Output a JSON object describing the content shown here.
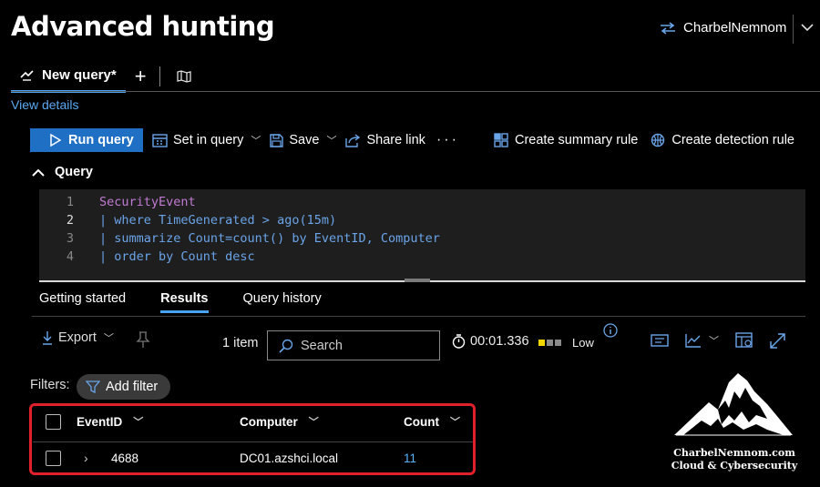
{
  "page": {
    "title": "Advanced hunting"
  },
  "user": {
    "name": "CharbelNemnom"
  },
  "tabs": {
    "active": "New query*"
  },
  "links": {
    "view_details": "View details"
  },
  "toolbar": {
    "run_query": "Run query",
    "set_in_query": "Set in query",
    "save": "Save",
    "share_link": "Share link",
    "more": "···",
    "create_summary_rule": "Create summary rule",
    "create_detection_rule": "Create detection rule"
  },
  "query": {
    "header": "Query",
    "line_numbers": [
      "1",
      "2",
      "3",
      "4"
    ],
    "lines": [
      "SecurityEvent",
      "| where TimeGenerated > ago(15m)",
      "| summarize Count=count() by EventID, Computer",
      "| order by Count desc"
    ]
  },
  "result_tabs": [
    "Getting started",
    "Results",
    "Query history"
  ],
  "results_toolbar": {
    "export": "Export",
    "items": "1 item",
    "search_placeholder": "Search",
    "elapsed": "00:01.336",
    "level": "Low",
    "level_colors": [
      "#f2d600",
      "#8a8a8a",
      "#8a8a8a"
    ]
  },
  "filters": {
    "label": "Filters:",
    "add_filter": "Add filter"
  },
  "table": {
    "columns": [
      "EventID",
      "Computer",
      "Count"
    ],
    "rows": [
      {
        "EventID": "4688",
        "Computer": "DC01.azshci.local",
        "Count": "11"
      }
    ]
  },
  "watermark": {
    "line1": "CharbelNemnom.com",
    "line2": "Cloud & Cybersecurity"
  },
  "colors": {
    "accent": "#1f6fc4",
    "link": "#5aa8f0",
    "highlight_box": "#e0202a"
  },
  "icons": [
    "switch-tenant-icon",
    "chevron-down-icon",
    "query-icon",
    "plus-icon",
    "map-icon",
    "play-icon",
    "calendar-icon",
    "save-icon",
    "share-icon",
    "summary-rule-icon",
    "detection-rule-icon",
    "chevron-up-icon",
    "download-icon",
    "pin-icon",
    "search-icon",
    "timer-icon",
    "info-icon",
    "chart-icon",
    "columns-icon",
    "expand-icon",
    "filter-icon",
    "mountain-logo"
  ]
}
